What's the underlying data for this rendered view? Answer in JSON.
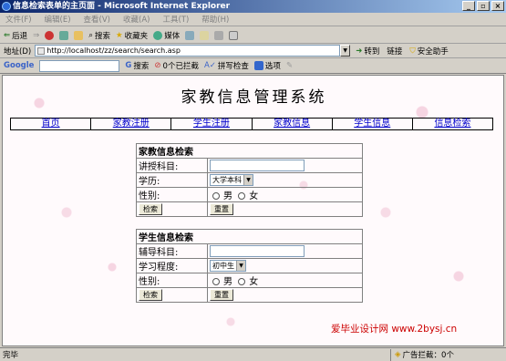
{
  "window": {
    "title": "信息检索表单的主页面 - Microsoft Internet Explorer",
    "controls": [
      "_",
      "▫",
      "×"
    ]
  },
  "menu": [
    "文件(F)",
    "编辑(E)",
    "查看(V)",
    "收藏(A)",
    "工具(T)",
    "帮助(H)"
  ],
  "toolbar": {
    "back": "后退",
    "search": "搜索",
    "favorites": "收藏夹",
    "media": "媒体"
  },
  "address": {
    "label": "地址(D)",
    "url": "http://localhost/zz/search/search.asp",
    "go": "转到",
    "links": "链接",
    "security": "安全助手"
  },
  "google_bar": {
    "logo": "Google",
    "search": "搜索",
    "blocked": "0个已拦截",
    "spell": "拼写检查",
    "options": "选项"
  },
  "page": {
    "heading": "家教信息管理系统",
    "nav": [
      "首页",
      "家教注册",
      "学生注册",
      "家教信息",
      "学生信息",
      "信息检索"
    ],
    "tutor_form": {
      "title": "家教信息检索",
      "subject_label": "讲授科目:",
      "education_label": "学历:",
      "education_value": "大学本科",
      "gender_label": "性别:",
      "male": "男",
      "female": "女",
      "search_btn": "检索",
      "reset_btn": "重置"
    },
    "student_form": {
      "title": "学生信息检索",
      "subject_label": "辅导科目:",
      "level_label": "学习程度:",
      "level_value": "初中生",
      "gender_label": "性别:",
      "male": "男",
      "female": "女",
      "search_btn": "检索",
      "reset_btn": "重置"
    },
    "footer": "爱毕业设计网 www.2bysj.cn"
  },
  "status": {
    "left": "完毕",
    "right": "广告拦截：0个"
  }
}
